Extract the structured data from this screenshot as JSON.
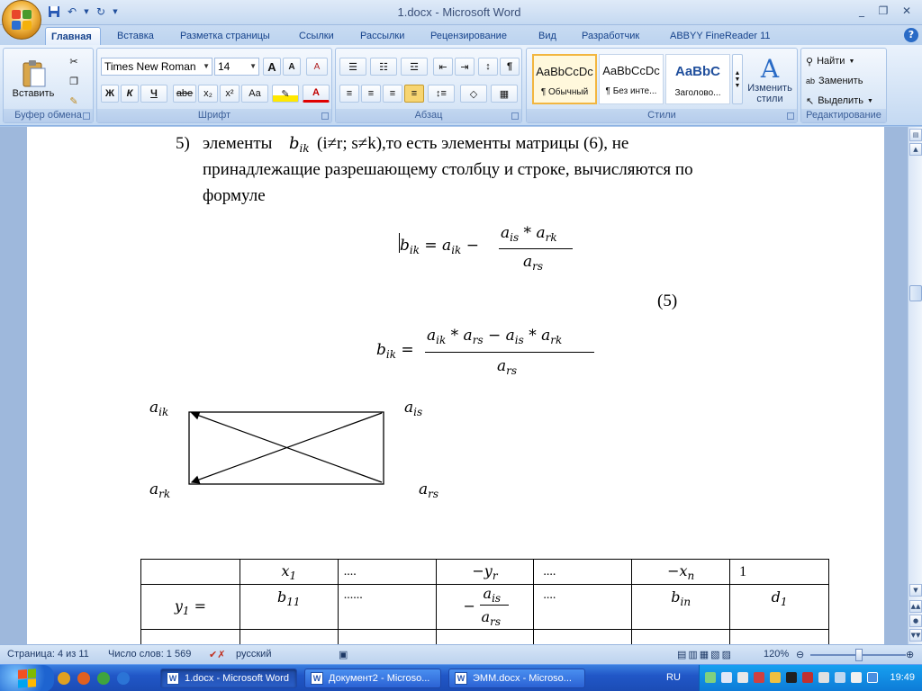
{
  "window": {
    "title": "1.docx - Microsoft Word"
  },
  "qat": {
    "save": "save-icon",
    "undo": "undo-icon",
    "redo": "redo-icon"
  },
  "tabs": [
    "Главная",
    "Вставка",
    "Разметка страницы",
    "Ссылки",
    "Рассылки",
    "Рецензирование",
    "Вид",
    "Разработчик",
    "ABBYY FineReader 11"
  ],
  "ribbon": {
    "clipboard": {
      "label": "Буфер обмена",
      "paste": "Вставить"
    },
    "font": {
      "label": "Шрифт",
      "family": "Times New Roman",
      "size": "14",
      "bold": "Ж",
      "italic": "К",
      "underline": "Ч",
      "strike": "abe",
      "sub": "x₂",
      "sup": "x²",
      "case": "Aa",
      "grow": "A",
      "shrink": "A",
      "clear": "A"
    },
    "paragraph": {
      "label": "Абзац",
      "pilcrow": "¶"
    },
    "styles": {
      "label": "Стили",
      "change": "Изменить стили",
      "items": [
        {
          "sample": "AaBbCcDc",
          "name": "¶ Обычный"
        },
        {
          "sample": "AaBbCcDc",
          "name": "¶ Без инте..."
        },
        {
          "sample": "AaBbC",
          "name": "Заголово..."
        }
      ]
    },
    "editing": {
      "label": "Редактирование",
      "find": "Найти",
      "replace": "Заменить",
      "select": "Выделить"
    }
  },
  "document": {
    "item_number": "5)",
    "line1_a": "элементы",
    "line1_b": "(i≠r; s≠k),то есть элементы матрицы (6), не",
    "line2": "принадлежащие разрешающему столбцу и строке, вычисляются по",
    "line3": "формуле",
    "eq_number": "(5)",
    "diagram": {
      "tl": "a",
      "tl_sub": "ik",
      "tr": "a",
      "tr_sub": "is",
      "bl": "a",
      "bl_sub": "rk",
      "br": "a",
      "br_sub": "rs"
    },
    "table": {
      "row1": [
        "",
        "x",
        "....",
        "−y",
        "....",
        "−x",
        "1"
      ],
      "row1_subs": [
        "",
        "1",
        "",
        "r",
        "",
        "n",
        ""
      ],
      "row2": [
        "y",
        "b",
        "......",
        "",
        "....",
        "b",
        "d"
      ],
      "row2_subs": [
        "1",
        "11",
        "",
        "",
        "",
        "in",
        "1"
      ]
    }
  },
  "status": {
    "page": "Страница: 4 из 11",
    "words": "Число слов: 1 569",
    "language": "русский",
    "zoom": "120%"
  },
  "taskbar": {
    "tasks": [
      "1.docx - Microsoft Word",
      "Документ2 - Microso...",
      "ЭММ.docx - Microso..."
    ],
    "lang": "RU",
    "clock": "19:49"
  }
}
